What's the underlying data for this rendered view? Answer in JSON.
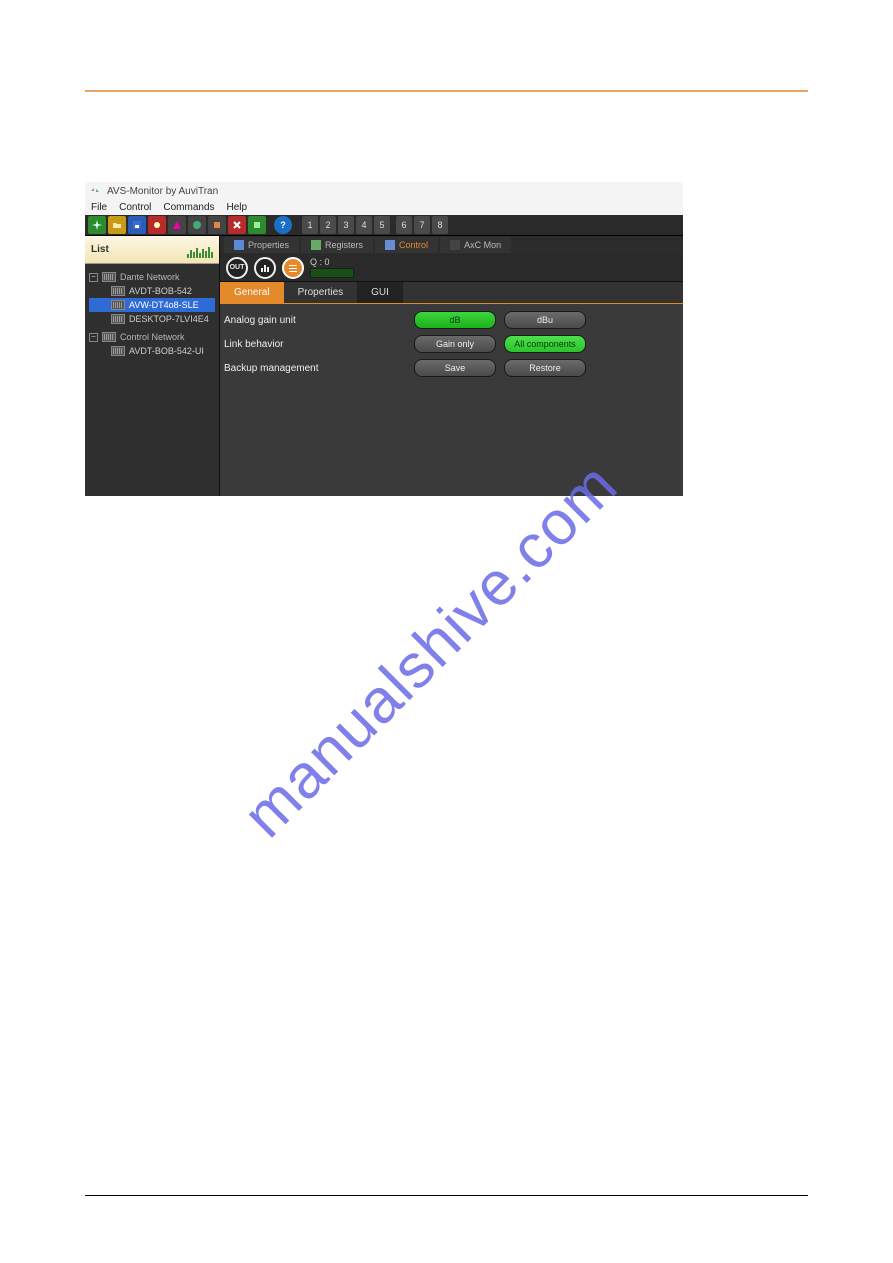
{
  "watermark": "manualshive.com",
  "window": {
    "title": "AVS-Monitor by AuviTran"
  },
  "menubar": [
    "File",
    "Control",
    "Commands",
    "Help"
  ],
  "toolbar_numbers": [
    "1",
    "2",
    "3",
    "4",
    "5",
    "6",
    "7",
    "8"
  ],
  "sidebar": {
    "title": "List",
    "groups": [
      {
        "name": "dante",
        "label": "Dante Network",
        "items": [
          {
            "label": "AVDT-BOB-542",
            "selected": false
          },
          {
            "label": "AVW-DT4o8-SLE",
            "selected": true
          },
          {
            "label": "DESKTOP-7LVI4E4",
            "selected": false
          }
        ]
      },
      {
        "name": "control",
        "label": "Control Network",
        "items": [
          {
            "label": "AVDT-BOB-542-UI",
            "selected": false
          }
        ]
      }
    ]
  },
  "toptabs": [
    {
      "label": "Properties",
      "id": "properties"
    },
    {
      "label": "Registers",
      "id": "registers"
    },
    {
      "label": "Control",
      "id": "control",
      "active": true
    },
    {
      "label": "AxC Mon",
      "id": "axcmon"
    }
  ],
  "outrow": {
    "out_label": "OUT",
    "q_label": "Q : 0"
  },
  "subtabs": [
    {
      "label": "General",
      "active": true
    },
    {
      "label": "Properties",
      "active": false
    },
    {
      "label": "GUI",
      "active": false,
      "dark": true
    }
  ],
  "settings": [
    {
      "id": "analog-gain",
      "label": "Analog gain unit",
      "options": [
        {
          "label": "dB",
          "style": "green"
        },
        {
          "label": "dBu",
          "style": "gray"
        }
      ]
    },
    {
      "id": "link-behavior",
      "label": "Link behavior",
      "options": [
        {
          "label": "Gain only",
          "style": "gray"
        },
        {
          "label": "All components",
          "style": "green2"
        }
      ]
    },
    {
      "id": "backup",
      "label": "Backup management",
      "options": [
        {
          "label": "Save",
          "style": "gray"
        },
        {
          "label": "Restore",
          "style": "gray"
        }
      ]
    }
  ]
}
